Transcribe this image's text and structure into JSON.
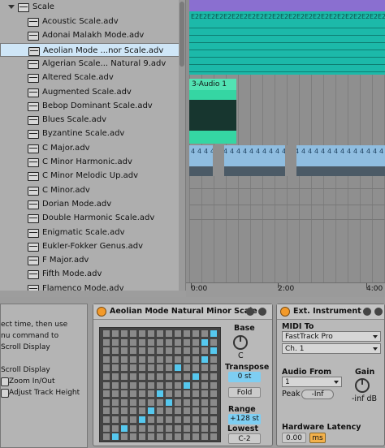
{
  "browser": {
    "root": {
      "label": "Scale"
    },
    "items": [
      {
        "label": "Acoustic Scale.adv"
      },
      {
        "label": "Adonai Malakh Mode.adv"
      },
      {
        "label": "Aeolian Mode ...nor Scale.adv",
        "selected": true
      },
      {
        "label": "Algerian Scale... Natural 9.adv"
      },
      {
        "label": "Altered Scale.adv"
      },
      {
        "label": "Augmented Scale.adv"
      },
      {
        "label": "Bebop Dominant Scale.adv"
      },
      {
        "label": "Blues Scale.adv"
      },
      {
        "label": "Byzantine Scale.adv"
      },
      {
        "label": "C Major.adv"
      },
      {
        "label": "C Minor Harmonic.adv"
      },
      {
        "label": "C Minor Melodic Up.adv"
      },
      {
        "label": "C Minor.adv"
      },
      {
        "label": "Dorian Mode.adv"
      },
      {
        "label": "Double Harmonic Scale.adv"
      },
      {
        "label": "Enigmatic Scale.adv"
      },
      {
        "label": "Eukler-Fokker Genus.adv"
      },
      {
        "label": "F Major.adv"
      },
      {
        "label": "Fifth Mode.adv"
      },
      {
        "label": "Flamenco Mode.adv"
      }
    ]
  },
  "arrangement": {
    "midi_clip_tag": "E2",
    "audio_clip": {
      "label": "3-Audio 1"
    },
    "blue_clip_tag": "4",
    "ruler": {
      "start": "0:00",
      "mid": "2:00",
      "end": "4:00"
    }
  },
  "info": {
    "lines": [
      "ect time, then use",
      "nu command to"
    ],
    "items": [
      "Scroll Display",
      "Zoom In/Out",
      "Adjust Track Height"
    ]
  },
  "scale_device": {
    "title": "Aeolian Mode Natural Minor Scale",
    "base": {
      "label": "Base",
      "value": "C"
    },
    "transpose": {
      "label": "Transpose",
      "value": "0 st"
    },
    "fold": {
      "label": "Fold"
    },
    "range": {
      "label": "Range",
      "value": "+128 st"
    },
    "lowest": {
      "label": "Lowest",
      "value": "C-2"
    },
    "grid_on": [
      [
        13,
        0
      ],
      [
        12,
        1
      ],
      [
        11,
        2
      ],
      [
        10,
        4
      ],
      [
        9,
        5
      ],
      [
        8,
        7
      ],
      [
        7,
        6
      ],
      [
        6,
        9
      ],
      [
        5,
        10
      ],
      [
        4,
        8
      ],
      [
        3,
        11
      ],
      [
        2,
        12
      ],
      [
        1,
        11
      ],
      [
        0,
        12
      ]
    ]
  },
  "instrument": {
    "title": "Ext. Instrument",
    "midi_to": {
      "label": "MIDI To",
      "device": "FastTrack Pro",
      "channel": "Ch. 1"
    },
    "audio_from": {
      "label": "Audio From",
      "value": "1",
      "peak_label": "Peak",
      "peak_value": "-Inf"
    },
    "gain": {
      "label": "Gain",
      "value": "-inf dB"
    },
    "latency": {
      "label": "Hardware Latency",
      "value": "0.00",
      "unit": "ms"
    }
  },
  "colors": {
    "accent_blue": "#7ecef2",
    "power_orange": "#f39a2a",
    "midi_teal": "#1cb9a9",
    "midi_purple": "#8a6fd0",
    "audio_green": "#35d6a3",
    "clip_blue": "#8fbde0"
  }
}
